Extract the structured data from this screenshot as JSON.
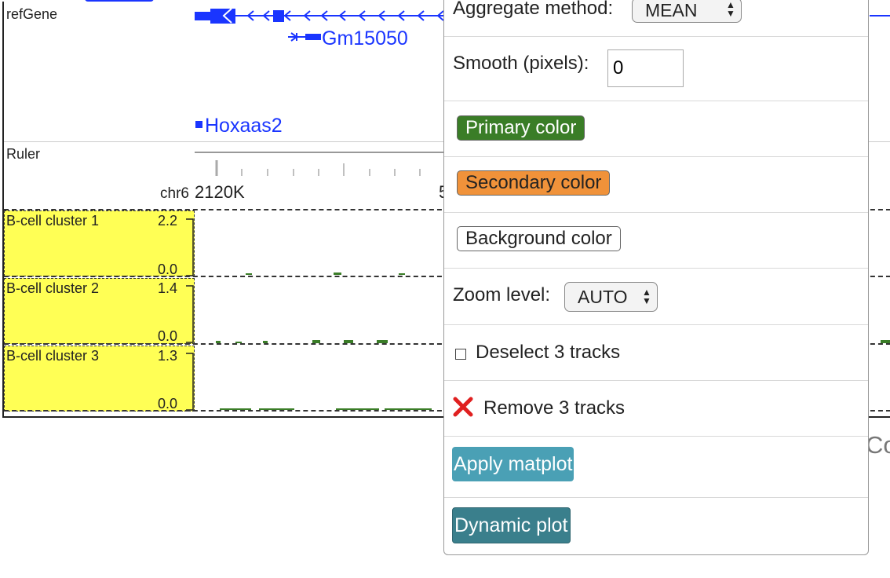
{
  "tracks": {
    "refgene_label": "refGene",
    "genes": [
      "Gm15050",
      "Hoxaas2"
    ],
    "ruler_label": "Ruler",
    "chrom": "chr6",
    "ruler_tick": "2120K",
    "ruler_tick_partial": "5",
    "clusters": [
      {
        "label": "B-cell cluster 1",
        "max": "2.2",
        "min": "0.0"
      },
      {
        "label": "B-cell cluster 2",
        "max": "1.4",
        "min": "0.0"
      },
      {
        "label": "B-cell cluster 3",
        "max": "1.3",
        "min": "0.0"
      }
    ],
    "right_partial_text": "Co"
  },
  "menu": {
    "aggregate_label": "Aggregate method:",
    "aggregate_value": "MEAN",
    "smooth_label": "Smooth (pixels):",
    "smooth_value": "0",
    "primary_color_label": "Primary color",
    "secondary_color_label": "Secondary color",
    "background_color_label": "Background color",
    "zoom_label": "Zoom level:",
    "zoom_value": "AUTO",
    "deselect_label": "Deselect 3 tracks",
    "remove_label": "Remove 3 tracks",
    "apply_matplot_label": "Apply matplot",
    "dynamic_plot_label": "Dynamic plot"
  },
  "colors": {
    "gene": "#1a35ff",
    "primary": "#3a7d27",
    "secondary": "#f0923a",
    "track_bg": "#ffff55",
    "apply_btn": "#4aa0b5",
    "dynamic_btn": "#3a7f8c",
    "remove_x": "#e02020"
  },
  "icons": {
    "deselect": "checkbox-icon",
    "remove": "x-icon",
    "select_arrows": "up-down-arrows-icon"
  }
}
